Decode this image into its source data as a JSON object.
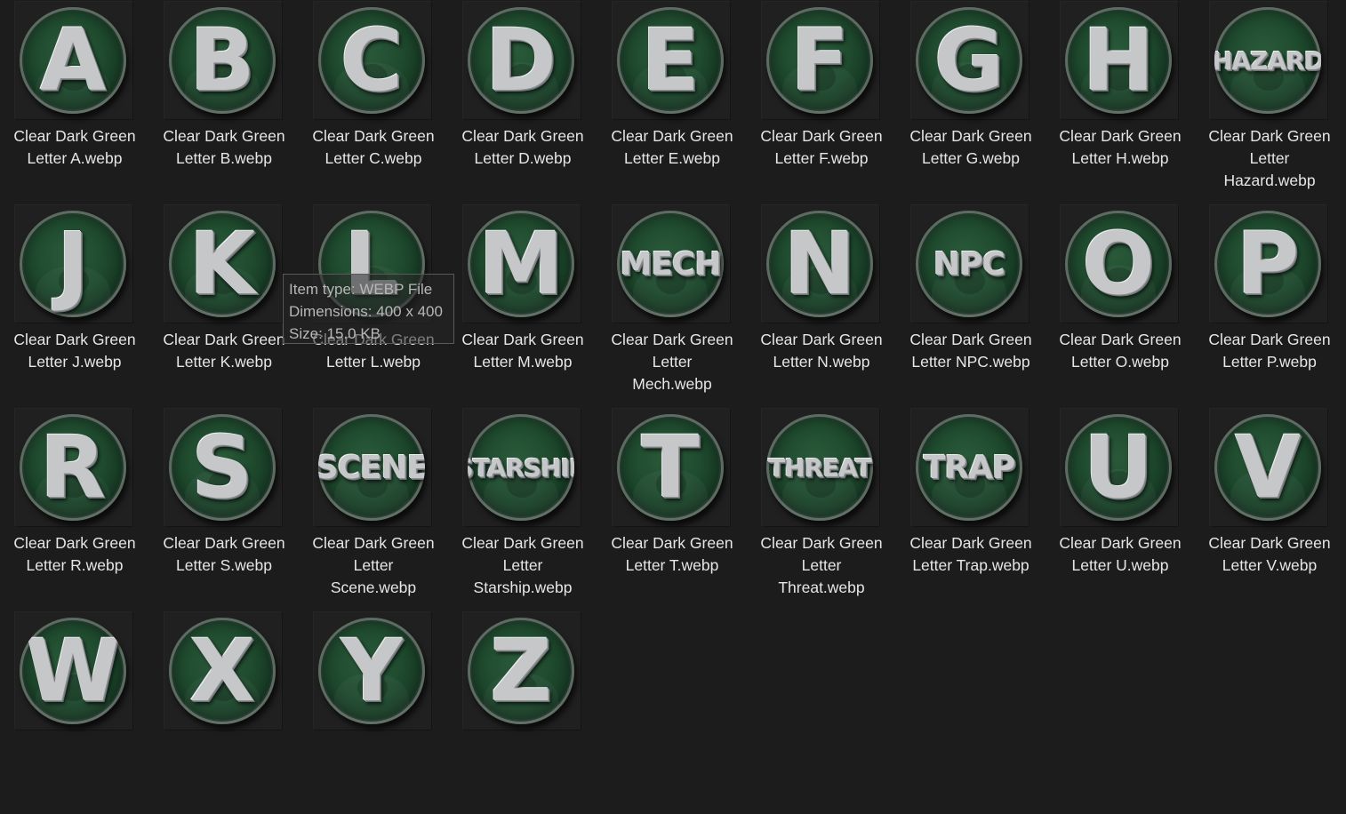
{
  "files": [
    {
      "badge": "A",
      "name": "Clear Dark Green\nLetter A.webp"
    },
    {
      "badge": "B",
      "name": "Clear Dark Green\nLetter B.webp"
    },
    {
      "badge": "C",
      "name": "Clear Dark Green\nLetter C.webp"
    },
    {
      "badge": "D",
      "name": "Clear Dark Green\nLetter D.webp"
    },
    {
      "badge": "E",
      "name": "Clear Dark Green\nLetter E.webp"
    },
    {
      "badge": "F",
      "name": "Clear Dark Green\nLetter F.webp"
    },
    {
      "badge": "G",
      "name": "Clear Dark Green\nLetter G.webp"
    },
    {
      "badge": "H",
      "name": "Clear Dark Green\nLetter H.webp"
    },
    {
      "badge": "HAZARD",
      "name": "Clear Dark Green\nLetter\nHazard.webp"
    },
    {
      "badge": "J",
      "name": "Clear Dark Green\nLetter J.webp"
    },
    {
      "badge": "K",
      "name": "Clear Dark Green\nLetter K.webp"
    },
    {
      "badge": "L",
      "name": "Clear Dark Green\nLetter L.webp"
    },
    {
      "badge": "M",
      "name": "Clear Dark Green\nLetter M.webp"
    },
    {
      "badge": "MECH",
      "name": "Clear Dark Green\nLetter\nMech.webp"
    },
    {
      "badge": "N",
      "name": "Clear Dark Green\nLetter N.webp"
    },
    {
      "badge": "NPC",
      "name": "Clear Dark Green\nLetter NPC.webp"
    },
    {
      "badge": "O",
      "name": "Clear Dark Green\nLetter O.webp"
    },
    {
      "badge": "P",
      "name": "Clear Dark Green\nLetter P.webp"
    },
    {
      "badge": "R",
      "name": "Clear Dark Green\nLetter R.webp"
    },
    {
      "badge": "S",
      "name": "Clear Dark Green\nLetter S.webp"
    },
    {
      "badge": "SCENE",
      "name": "Clear Dark Green\nLetter\nScene.webp"
    },
    {
      "badge": "STARSHIP",
      "name": "Clear Dark Green\nLetter\nStarship.webp"
    },
    {
      "badge": "T",
      "name": "Clear Dark Green\nLetter T.webp"
    },
    {
      "badge": "THREAT",
      "name": "Clear Dark Green\nLetter\nThreat.webp"
    },
    {
      "badge": "TRAP",
      "name": "Clear Dark Green\nLetter Trap.webp"
    },
    {
      "badge": "U",
      "name": "Clear Dark Green\nLetter U.webp"
    },
    {
      "badge": "V",
      "name": "Clear Dark Green\nLetter V.webp"
    },
    {
      "badge": "W",
      "name": ""
    },
    {
      "badge": "X",
      "name": ""
    },
    {
      "badge": "Y",
      "name": ""
    },
    {
      "badge": "Z",
      "name": ""
    }
  ],
  "tooltip": {
    "item_type": "Item type: WEBP File",
    "dimensions": "Dimensions: 400 x 400",
    "size": "Size: 15.0 KB"
  },
  "colors": {
    "background": "#1c1c1c",
    "label_text": "#e6e6e6",
    "badge_green": "#1f4a2e",
    "letter_silver": "#c5c7c9",
    "tooltip_text": "#b7b7b7",
    "tooltip_border": "#5a5a5a"
  }
}
